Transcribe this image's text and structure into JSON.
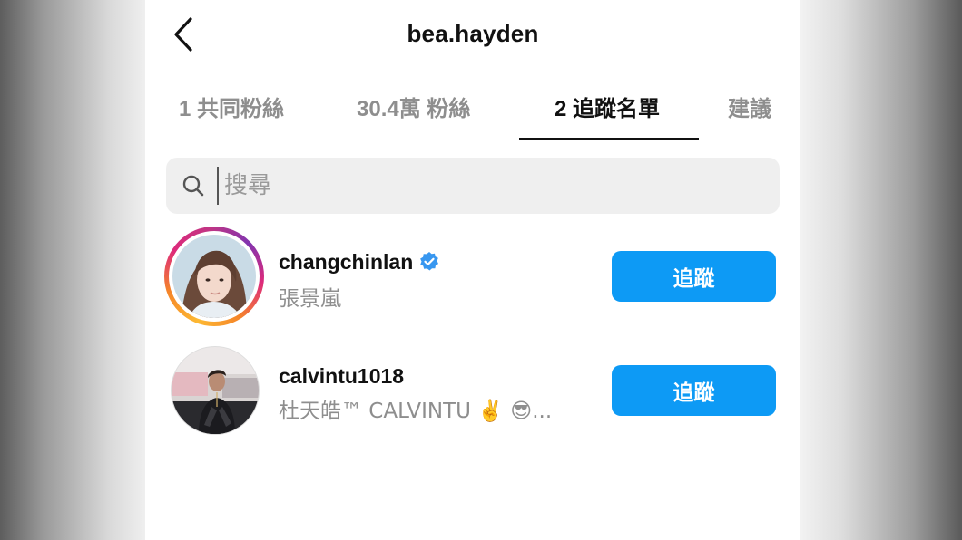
{
  "header": {
    "title": "bea.hayden"
  },
  "tabs": [
    {
      "label": "1 共同粉絲"
    },
    {
      "label": "30.4萬 粉絲"
    },
    {
      "label": "2 追蹤名單",
      "active": true
    },
    {
      "label": "建議"
    }
  ],
  "search": {
    "placeholder": "搜尋"
  },
  "users": [
    {
      "username": "changchinlan",
      "fullname": "張景嵐",
      "verified": true,
      "has_story": true,
      "button_label": "追蹤"
    },
    {
      "username": "calvintu1018",
      "fullname": "杜天皓™ CALVINTU ✌️ 😎...",
      "verified": false,
      "has_story": false,
      "button_label": "追蹤"
    }
  ],
  "colors": {
    "accent": "#0d9af5",
    "verified": "#3897f0",
    "muted_text": "#8e8e8e"
  },
  "icons": {
    "back": "chevron-left-icon",
    "search": "search-icon",
    "verified": "verified-badge-icon"
  }
}
